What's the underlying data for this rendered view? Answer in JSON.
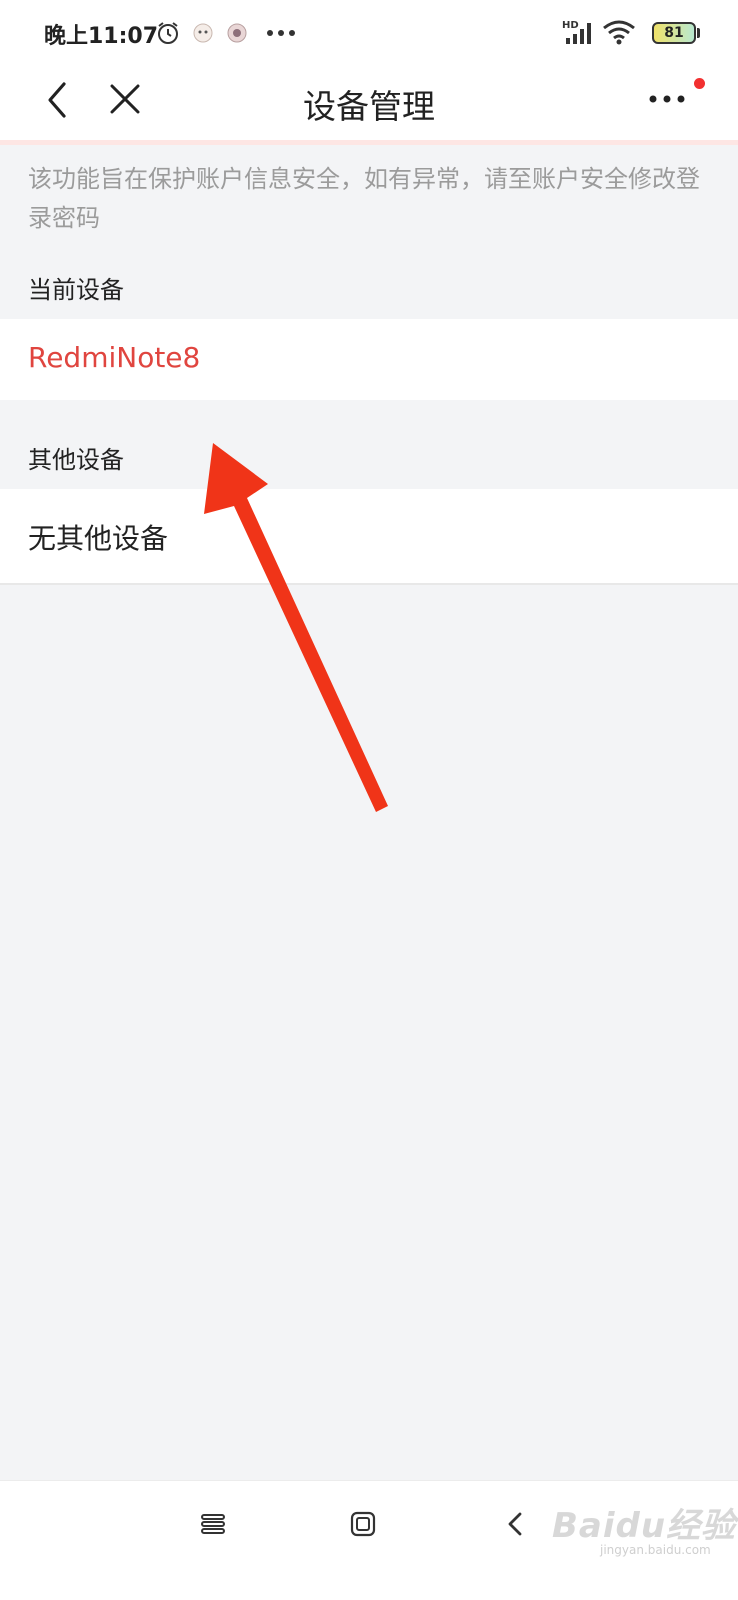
{
  "status_bar": {
    "time": "晚上11:07",
    "battery_level": "81",
    "icons": [
      "alarm-icon",
      "app-notification-icon",
      "app-notification-icon",
      "more-dots-icon",
      "hd-signal-icon",
      "wifi-icon",
      "battery-icon"
    ]
  },
  "nav": {
    "title": "设备管理",
    "back_icon": "chevron-left-icon",
    "close_icon": "close-icon",
    "more_icon": "more-horizontal-icon",
    "badge_color": "#f23030"
  },
  "notice": "该功能旨在保护账户信息安全，如有异常，请至账户安全修改登录密码",
  "current_section": {
    "label": "当前设备",
    "device": "RedmiNote8",
    "device_color": "#e0453f"
  },
  "other_section": {
    "label": "其他设备",
    "empty_text": "无其他设备"
  },
  "annotation_arrow_color": "#f03418",
  "system_nav": {
    "icons": [
      "menu-icon",
      "home-square-icon",
      "back-chevron-icon"
    ]
  },
  "watermark": {
    "text": "Baidu经验",
    "sub": "jingyan.baidu.com"
  }
}
